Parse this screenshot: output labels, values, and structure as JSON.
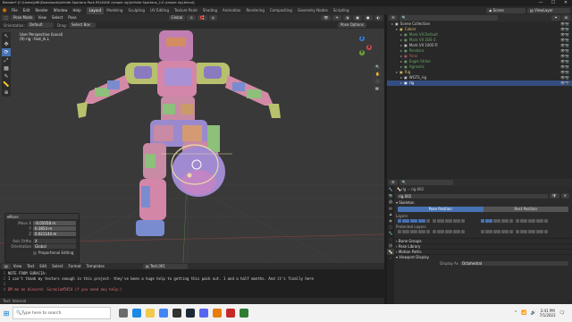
{
  "window": {
    "title": "Blender* [C:\\Users\\jdffr\\Downloads\\Infinite Spartans Pack RELEASE (simple rig)\\Infinite Spartans_2.0 (simple rig).blend]",
    "min": "—",
    "max": "☐",
    "close": "✕"
  },
  "menubar": {
    "items": [
      "File",
      "Edit",
      "Render",
      "Window",
      "Help"
    ],
    "workspaces": [
      "Layout",
      "Modeling",
      "Sculpting",
      "UV Editing",
      "Texture Paint",
      "Shading",
      "Animation",
      "Rendering",
      "Compositing",
      "Geometry Nodes",
      "Scripting"
    ],
    "active_workspace": "Layout",
    "scene_label": "Scene",
    "viewlayer_label": "ViewLayer"
  },
  "viewport_header": {
    "mode": "Pose Mode",
    "menus": [
      "View",
      "Select",
      "Pose"
    ],
    "orientation": "Global",
    "row2": {
      "orientation_label": "Orientation:",
      "orientation_value": "Default",
      "drag_label": "Drag:",
      "drag_value": "Select Box"
    },
    "pivot_options": "Pose Options"
  },
  "viewport": {
    "view_name": "User Perspective (Local)",
    "object_info": "(9) rig : foot_ik.L",
    "gizmo": {
      "x": "X",
      "y": "Y",
      "z": "Z"
    }
  },
  "toolbar": [
    "↖",
    "✥",
    "⟳",
    "⤢",
    "▦",
    "✎",
    "📏",
    "⊕"
  ],
  "redo_panel": {
    "title": "Move",
    "fields": [
      {
        "label": "Move X",
        "value": "-0.05058 m"
      },
      {
        "label": "Y",
        "value": "0.3854 m"
      },
      {
        "label": "Z",
        "value": "0.021144 m"
      }
    ],
    "axis_ortho_label": "Axis Ortho",
    "axis_ortho_value": "X",
    "orientation_label": "Orientation",
    "orientation_value": "Global",
    "proportional_label": "Proportional Editing"
  },
  "text_editor": {
    "menus": [
      "View",
      "Text",
      "Edit",
      "Select",
      "Format",
      "Templates"
    ],
    "file_name": "Text.001",
    "lines": [
      {
        "n": "1",
        "text": "NOTE FROM SURACIA:"
      },
      {
        "n": "2",
        "text": "I can't thank my testers enough in this project- they've been a huge help to getting this pack out. 1 and a half months. And it's finally here"
      },
      {
        "n": "3",
        "text": ""
      },
      {
        "n": "4",
        "text": "DM me on discord: Suracia#5454 if you need any help:)"
      }
    ],
    "footer": "Text: Internal"
  },
  "outliner": {
    "title": "Scene Collection",
    "rows": [
      {
        "indent": 1,
        "label": "Scene Collection",
        "color": "#cfcfcf",
        "selected": false
      },
      {
        "indent": 2,
        "label": "Colors",
        "color": "#d9c26a",
        "selected": false
      },
      {
        "indent": 3,
        "label": "Mark VII Default",
        "color": "#6ba86b",
        "selected": false
      },
      {
        "indent": 3,
        "label": "Mark VII 3DS-3",
        "color": "#6ba86b",
        "selected": false
      },
      {
        "indent": 3,
        "label": "Mark VII 1005-Tr",
        "color": "#cfcfcf",
        "selected": false
      },
      {
        "indent": 3,
        "label": "Pandora",
        "color": "#6ba86b",
        "selected": false
      },
      {
        "indent": 3,
        "label": "Yoroi",
        "color": "#c06060",
        "selected": false
      },
      {
        "indent": 3,
        "label": "Eagle Strike",
        "color": "#6ba86b",
        "selected": false
      },
      {
        "indent": 3,
        "label": "Agnostic",
        "color": "#6ba86b",
        "selected": false
      },
      {
        "indent": 2,
        "label": "Rig",
        "color": "#d9c26a",
        "selected": false
      },
      {
        "indent": 3,
        "label": "WGTS_rig",
        "color": "#cfcfcf",
        "selected": false
      },
      {
        "indent": 3,
        "label": "rig",
        "color": "#ffffff",
        "selected": true
      }
    ]
  },
  "properties": {
    "breadcrumb_rig": "rig",
    "breadcrumb_data": "rig.002",
    "datablock": "rig.002",
    "skeleton_label": "Skeleton",
    "pose_position": "Pose Position",
    "rest_position": "Rest Position",
    "layers_label": "Layers",
    "protected_layers_label": "Protected Layers",
    "collapsed_sections": [
      "Bone Groups",
      "Pose Library",
      "Motion Paths",
      "Viewport Display"
    ],
    "display_as_label": "Display As",
    "display_as_value": "Octahedral"
  },
  "taskbar": {
    "search_placeholder": "Type here to search",
    "time": "2:41 PM",
    "date": "7/1/2022"
  },
  "colors": {
    "accent_blue": "#4772b3",
    "selection_blue": "#334d80",
    "viewport_bg": "#393939",
    "active_bone": "#e8d9a8"
  }
}
